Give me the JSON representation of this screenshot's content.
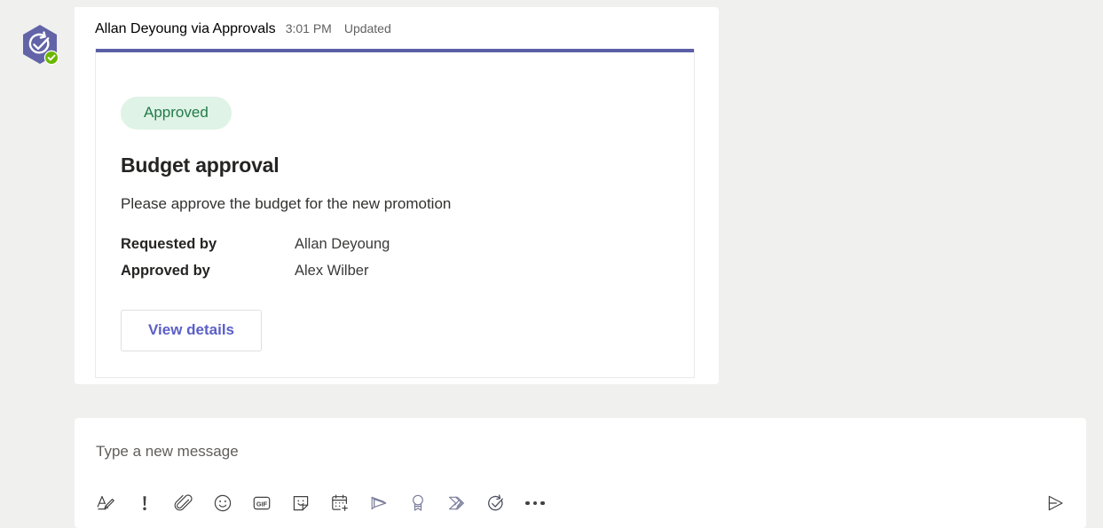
{
  "message": {
    "avatar_icon": "approvals-app-icon",
    "avatar_badge_icon": "green-check-badge-icon",
    "sender": "Allan Deyoung via Approvals",
    "time": "3:01 PM",
    "status": "Updated"
  },
  "card": {
    "accent_color": "#5b5fa6",
    "status_badge": {
      "label": "Approved",
      "background": "#dff3e6",
      "text_color": "#237b4b"
    },
    "title": "Budget approval",
    "description": "Please approve the budget for the new promotion",
    "facts": [
      {
        "label": "Requested by",
        "value": "Allan Deyoung"
      },
      {
        "label": "Approved by",
        "value": "Alex Wilber"
      }
    ],
    "action_button": {
      "label": "View details",
      "text_color": "#5b5fc7"
    }
  },
  "composer": {
    "placeholder": "Type a new message",
    "value": "",
    "toolbar": [
      {
        "name": "format-icon",
        "title": "Format"
      },
      {
        "name": "importance-icon",
        "title": "Set delivery options"
      },
      {
        "name": "attach-icon",
        "title": "Attach"
      },
      {
        "name": "emoji-icon",
        "title": "Emoji"
      },
      {
        "name": "gif-icon",
        "title": "Giphy"
      },
      {
        "name": "sticker-icon",
        "title": "Sticker"
      },
      {
        "name": "meeting-icon",
        "title": "Schedule a meeting"
      },
      {
        "name": "stream-icon",
        "title": "Stream"
      },
      {
        "name": "praise-icon",
        "title": "Praise"
      },
      {
        "name": "power-automate-icon",
        "title": "Power Automate"
      },
      {
        "name": "approvals-icon",
        "title": "Approvals"
      },
      {
        "name": "more-options-icon",
        "title": "More options"
      }
    ],
    "send": {
      "name": "send-icon",
      "title": "Send"
    }
  }
}
